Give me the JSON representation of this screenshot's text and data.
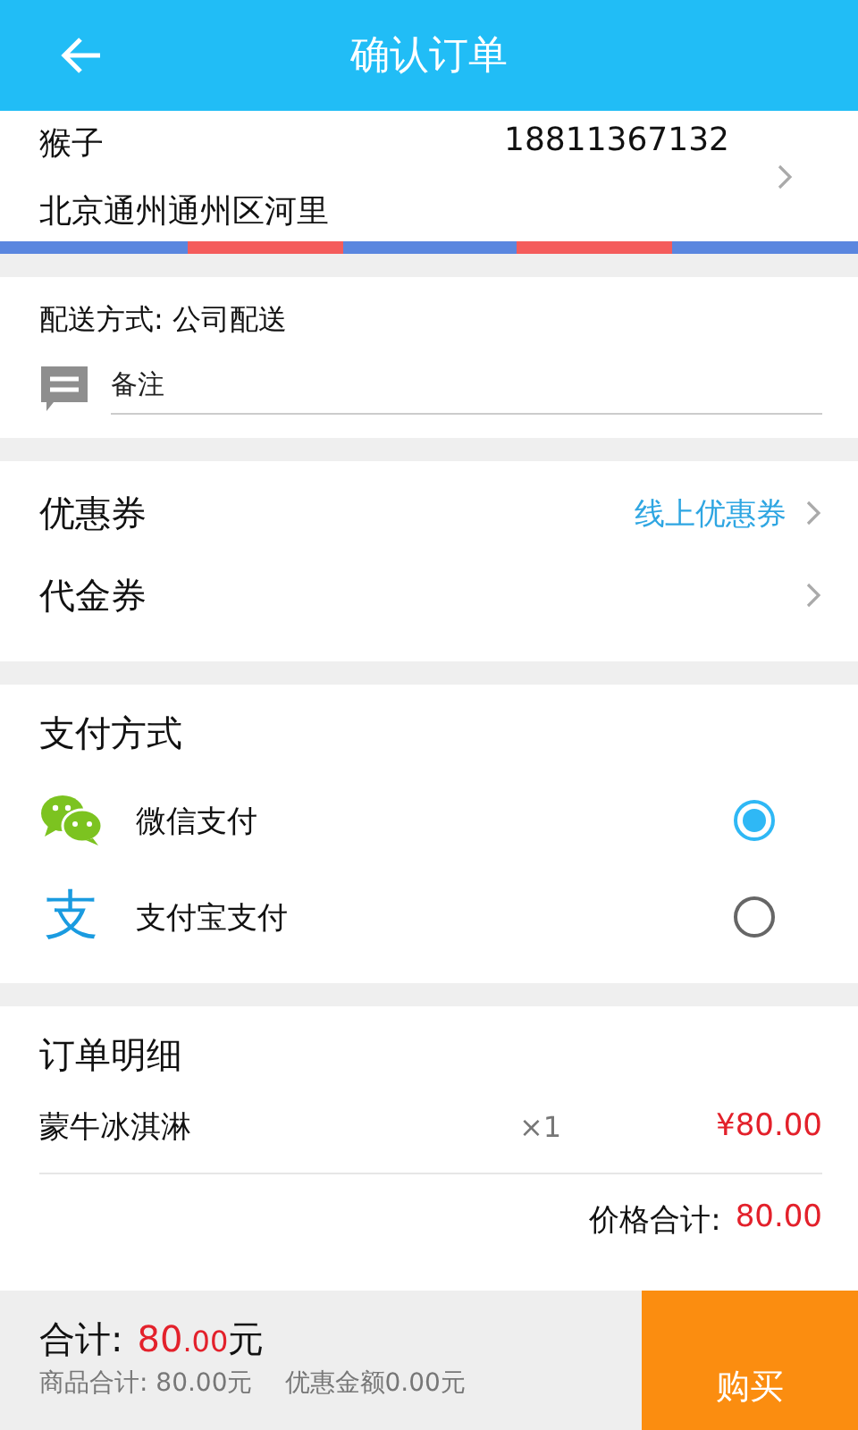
{
  "header": {
    "title": "确认订单"
  },
  "address": {
    "name": "猴子",
    "phone": "18811367132",
    "address": "北京通州通州区河里"
  },
  "delivery": {
    "method": "配送方式: 公司配送",
    "note_placeholder": "备注"
  },
  "discounts": [
    {
      "label": "优惠券",
      "value": "线上优惠券"
    },
    {
      "label": "代金券"
    }
  ],
  "payment": {
    "title": "支付方式",
    "methods": [
      {
        "kind": "wechat",
        "label": "微信支付",
        "selected": true
      },
      {
        "kind": "alipay",
        "icon": "支",
        "label": "支付宝支付",
        "selected": false
      }
    ]
  },
  "order": {
    "title": "订单明细",
    "items": [
      {
        "name": "蒙牛冰淇淋",
        "quantity": "×1",
        "price": "¥80.00"
      }
    ],
    "total_label": "价格合计:",
    "total_value": "80.00"
  },
  "footer": {
    "total_label": "合计:",
    "amount_int": "80",
    "amount_dec": ".00",
    "unit": "元",
    "goods_total": "商品合计: 80.00元",
    "discount_total": "优惠金额0.00元",
    "buy": "购买"
  }
}
